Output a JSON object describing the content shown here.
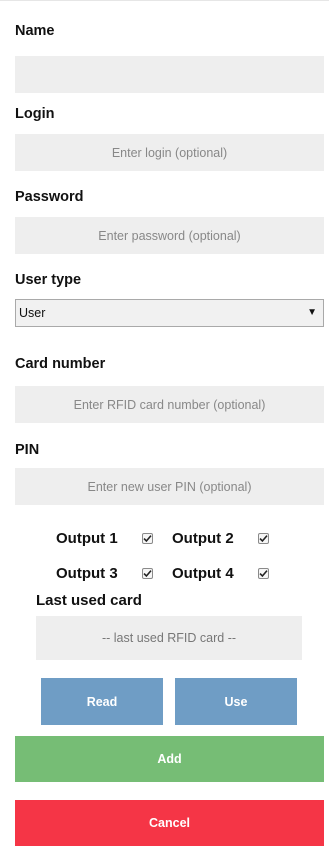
{
  "form": {
    "name": {
      "label": "Name",
      "value": "",
      "placeholder": ""
    },
    "login": {
      "label": "Login",
      "value": "",
      "placeholder": "Enter login (optional)"
    },
    "password": {
      "label": "Password",
      "value": "",
      "placeholder": "Enter password (optional)"
    },
    "user_type": {
      "label": "User type",
      "selected": "User",
      "arrow": "▼"
    },
    "card_number": {
      "label": "Card number",
      "value": "",
      "placeholder": "Enter RFID card number (optional)"
    },
    "pin": {
      "label": "PIN",
      "value": "",
      "placeholder": "Enter new user PIN (optional)"
    }
  },
  "outputs": [
    {
      "label": "Output 1",
      "checked": true
    },
    {
      "label": "Output 2",
      "checked": true
    },
    {
      "label": "Output 3",
      "checked": true
    },
    {
      "label": "Output 4",
      "checked": true
    }
  ],
  "last_used_card": {
    "label": "Last used card",
    "value": "-- last used RFID card --"
  },
  "buttons": {
    "read": "Read",
    "use": "Use",
    "add": "Add",
    "cancel": "Cancel"
  },
  "colors": {
    "field_bg": "#eeeeee",
    "read_use_bg": "#6f9dc5",
    "add_bg": "#76bd75",
    "cancel_bg": "#f53546"
  },
  "icons": {
    "checkbox": "checkmark-icon",
    "select_arrow": "chevron-down-icon"
  }
}
